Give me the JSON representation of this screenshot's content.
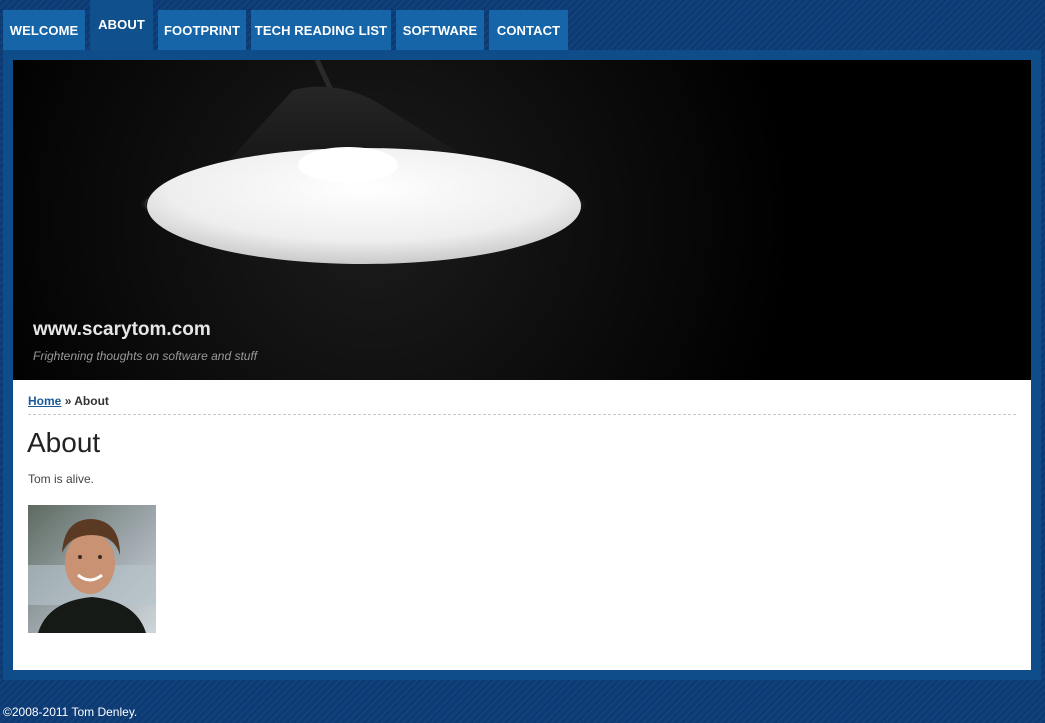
{
  "nav": {
    "tabs": [
      {
        "label": "WELCOME"
      },
      {
        "label": "ABOUT"
      },
      {
        "label": "FOOTPRINT"
      },
      {
        "label": "TECH READING LIST"
      },
      {
        "label": "SOFTWARE"
      },
      {
        "label": "CONTACT"
      }
    ],
    "active_tab": "ABOUT"
  },
  "header": {
    "site_title": "www.scarytom.com",
    "tagline": "Frightening thoughts on software and stuff",
    "banner_image": "lamp-shade-photo"
  },
  "breadcrumb": {
    "home_label": "Home",
    "separator": "»",
    "current_label": "About"
  },
  "page": {
    "heading": "About",
    "body_text": "Tom is alive.",
    "photo": "portrait-photo"
  },
  "footer": {
    "copyright": "©2008-2011 Tom Denley."
  },
  "colors": {
    "background": "#0b3a74",
    "tab": "#1565a8",
    "link": "#1a5a9a"
  }
}
